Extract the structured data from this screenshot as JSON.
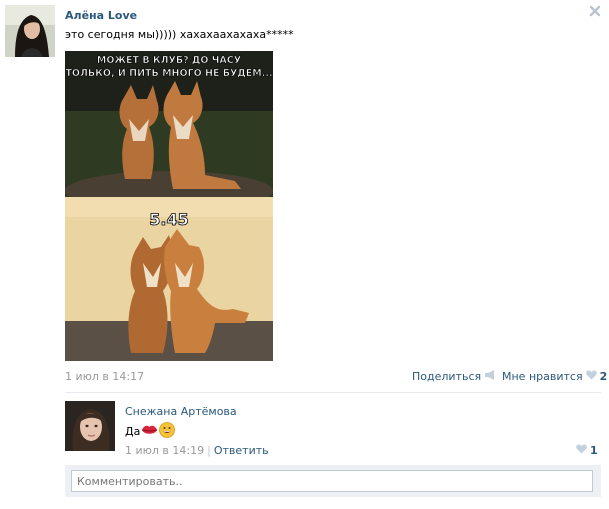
{
  "post": {
    "author": "Алёна Love",
    "text": "это сегодня мы))))) хахахаахахаха*****",
    "image": {
      "top_caption": "МОЖЕТ В КЛУБ? ДО ЧАСУ ТОЛЬКО, И ПИТЬ МНОГО НЕ БУДЕМ...",
      "top_caption_line1": "МОЖЕТ В КЛУБ? ДО ЧАСУ",
      "top_caption_line2": "ТОЛЬКО, И ПИТЬ МНОГО НЕ БУДЕМ...",
      "bottom_caption": "5.45"
    },
    "date": "1 июл в 14:17",
    "share_label": "Поделиться",
    "like_label": "Мне нравится",
    "like_count": "2"
  },
  "comment": {
    "author": "Снежана Артёмова",
    "text": "Да",
    "emoji": [
      "kiss-lips",
      "grin"
    ],
    "date": "1 июл в 14:19",
    "separator": "|",
    "reply_label": "Ответить",
    "like_count": "1"
  },
  "comment_box": {
    "placeholder": "Комментировать.."
  },
  "icons": {
    "close": "close-icon",
    "share": "megaphone-icon",
    "like": "heart-icon"
  },
  "colors": {
    "link": "#2b587a",
    "muted": "#999999",
    "heart": "#c3d1de",
    "comment_bg": "#edf1f5"
  }
}
